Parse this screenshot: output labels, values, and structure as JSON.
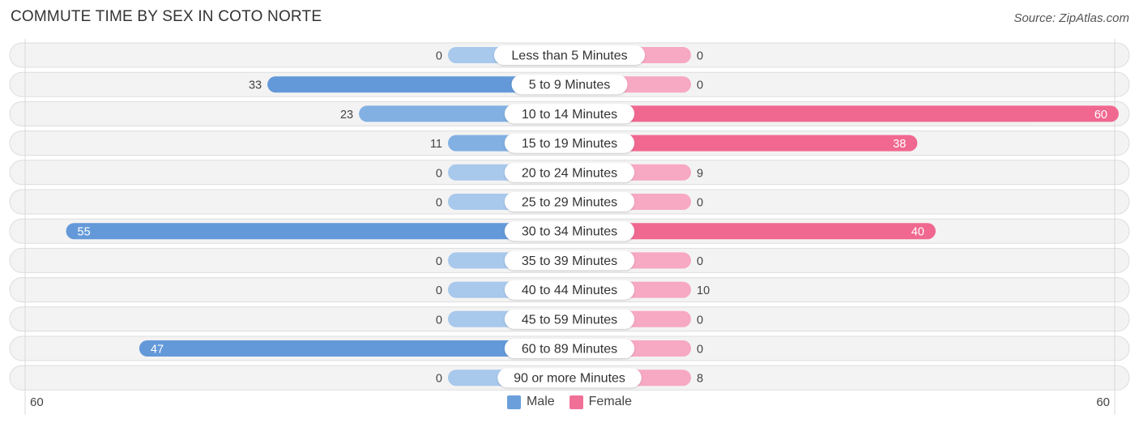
{
  "title": "COMMUTE TIME BY SEX IN COTO NORTE",
  "source": "Source: ZipAtlas.com",
  "axis": {
    "left_label": "60",
    "right_label": "60"
  },
  "legend": [
    {
      "name": "Male",
      "color": "#6a9fdc"
    },
    {
      "name": "Female",
      "color": "#f07098"
    }
  ],
  "colors": {
    "male_strong": "#6499d9",
    "male_light": "#a8c8ec",
    "female_strong": "#f06890",
    "female_light": "#f7a8c2",
    "track": "#f3f3f3",
    "track_border": "#dddddd"
  },
  "chart_data": {
    "type": "bar",
    "orientation": "horizontal-diverging",
    "title": "COMMUTE TIME BY SEX IN COTO NORTE",
    "categories": [
      "Less than 5 Minutes",
      "5 to 9 Minutes",
      "10 to 14 Minutes",
      "15 to 19 Minutes",
      "20 to 24 Minutes",
      "25 to 29 Minutes",
      "30 to 34 Minutes",
      "35 to 39 Minutes",
      "40 to 44 Minutes",
      "45 to 59 Minutes",
      "60 to 89 Minutes",
      "90 or more Minutes"
    ],
    "series": [
      {
        "name": "Male",
        "values": [
          0,
          33,
          23,
          11,
          0,
          0,
          55,
          0,
          0,
          0,
          47,
          0
        ]
      },
      {
        "name": "Female",
        "values": [
          0,
          0,
          60,
          38,
          9,
          0,
          40,
          0,
          10,
          0,
          0,
          8
        ]
      }
    ],
    "xlim": [
      -60,
      60
    ],
    "tick_labels": [
      "60",
      "60"
    ],
    "legend_position": "bottom-center",
    "grid": false
  }
}
